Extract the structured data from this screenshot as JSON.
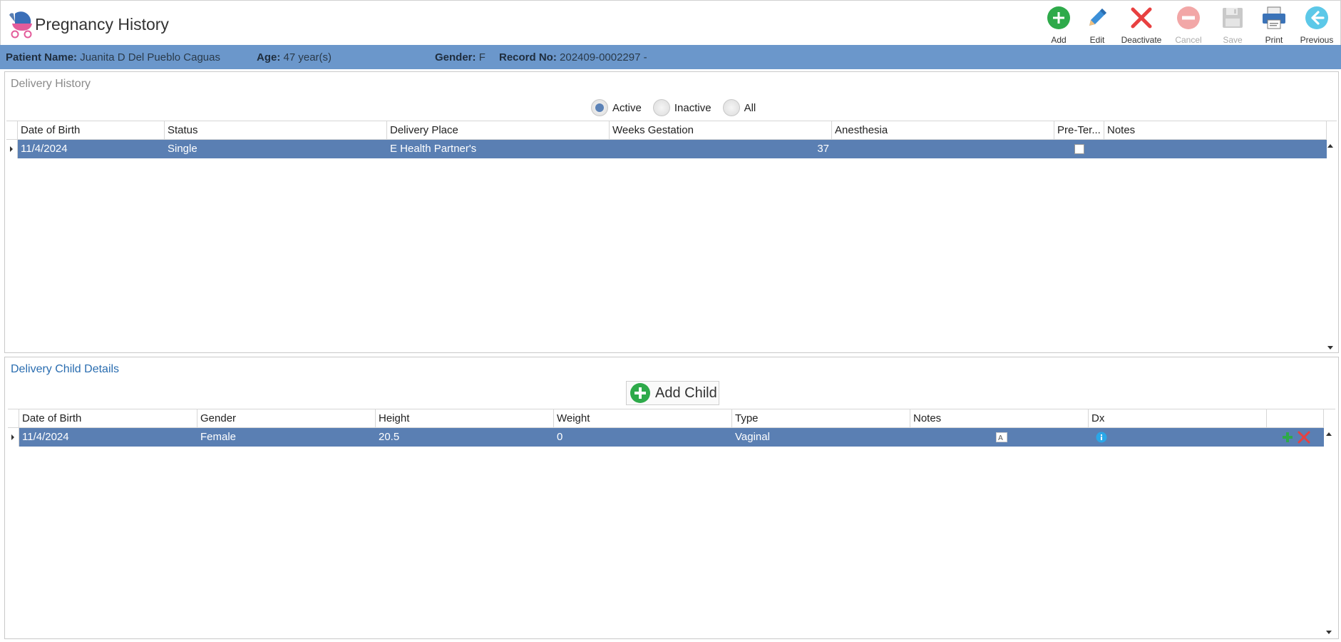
{
  "header": {
    "title": "Pregnancy History",
    "toolbar": [
      {
        "id": "add",
        "label": "Add",
        "icon": "add-icon",
        "enabled": true
      },
      {
        "id": "edit",
        "label": "Edit",
        "icon": "pencil-icon",
        "enabled": true
      },
      {
        "id": "deactivate",
        "label": "Deactivate",
        "icon": "x-icon",
        "enabled": true
      },
      {
        "id": "cancel",
        "label": "Cancel",
        "icon": "minus-circle-icon",
        "enabled": false
      },
      {
        "id": "save",
        "label": "Save",
        "icon": "floppy-icon",
        "enabled": false
      },
      {
        "id": "print",
        "label": "Print",
        "icon": "printer-icon",
        "enabled": true
      },
      {
        "id": "previous",
        "label": "Previous",
        "icon": "arrow-left-icon",
        "enabled": true
      }
    ]
  },
  "patient": {
    "name_label": "Patient Name:",
    "name": "Juanita D Del Pueblo Caguas",
    "age_label": "Age:",
    "age": "47 year(s)",
    "gender_label": "Gender:",
    "gender": "F",
    "record_label": "Record No:",
    "record": "202409-0002297 -"
  },
  "delivery_history": {
    "title": "Delivery History",
    "filters": [
      "Active",
      "Inactive",
      "All"
    ],
    "selected_filter": "Active",
    "columns": [
      "Date of Birth",
      "Status",
      "Delivery Place",
      "Weeks Gestation",
      "Anesthesia",
      "Pre-Ter...",
      "Notes"
    ],
    "rows": [
      {
        "dob": "11/4/2024",
        "status": "Single",
        "place": "E Health Partner's",
        "weeks": "37",
        "anesthesia": "",
        "preterm": false,
        "notes": ""
      }
    ]
  },
  "child_details": {
    "title": "Delivery Child Details",
    "add_child_label": "Add Child",
    "columns": [
      "Date of Birth",
      "Gender",
      "Height",
      "Weight",
      "Type",
      "Notes",
      "Dx",
      ""
    ],
    "rows": [
      {
        "dob": "11/4/2024",
        "gender": "Female",
        "height": "20.5",
        "weight": "0",
        "type": "Vaginal",
        "notes": "",
        "dx": ""
      }
    ]
  },
  "colors": {
    "patient_bar": "#6b97cb",
    "selected_row": "#5a7fb3",
    "accent_green": "#2eaa4a",
    "accent_red": "#e84040"
  }
}
